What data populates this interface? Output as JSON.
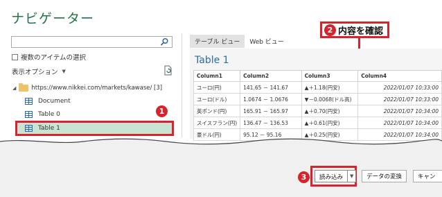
{
  "navigator": {
    "title": "ナビゲーター",
    "search_placeholder": "",
    "multi_select_label": "複数のアイテムの選択",
    "display_options_label": "表示オプション",
    "tree": {
      "root_label": "https://www.nikkei.com/markets/kawase/ [3]",
      "items": [
        {
          "label": "Document"
        },
        {
          "label": "Table 0"
        },
        {
          "label": "Table 1",
          "selected": true
        }
      ]
    }
  },
  "preview": {
    "tabs": [
      {
        "label": "テーブル ビュー",
        "active": true
      },
      {
        "label": "Web ビュー",
        "active": false
      }
    ],
    "title": "Table 1",
    "columns": [
      "Column1",
      "Column2",
      "Column3",
      "Column4"
    ],
    "rows": [
      [
        "ユーロ(円)",
        "141.65 － 141.67",
        "▲＋1.18(円安)",
        "2022/01/07 10:33:00"
      ],
      [
        "ユーロ(ドル)",
        "1.0674 － 1.0676",
        "▼－0.0068(ドル高)",
        "2022/01/07 10:33:00"
      ],
      [
        "英ポンド(円)",
        "165.91 － 165.97",
        "▲＋0.70(円安)",
        "2022/01/07 10:34:00"
      ],
      [
        "スイスフラン(円)",
        "136.47 － 136.53",
        "▲＋0.61(円安)",
        "2022/01/07 10:34:00"
      ],
      [
        "豪ドル(円)",
        "95.12 － 95.16",
        "▲＋0.25(円安)",
        "2022/01/07 10:34:00"
      ]
    ]
  },
  "annotations": {
    "badge_1": "1",
    "badge_2": "2",
    "badge_3": "3",
    "callout_2_text": "内容を確認"
  },
  "buttons": {
    "load": "読み込み",
    "transform": "データの変換",
    "cancel": "キャン"
  },
  "colors": {
    "title_green": "#217346",
    "accent_red": "#d6242e",
    "selected_bg": "#c9e4d2",
    "preview_title_blue": "#2c6aa8"
  }
}
